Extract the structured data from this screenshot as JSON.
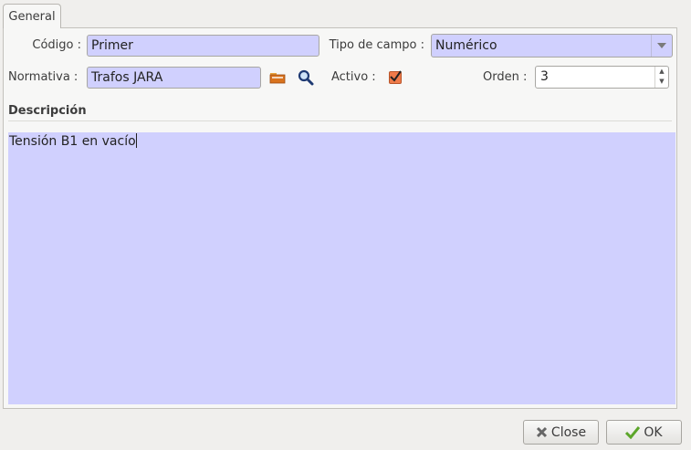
{
  "tabs": [
    {
      "label": "General",
      "active": true
    }
  ],
  "form": {
    "codigo": {
      "label": "Código :",
      "value": "Primer"
    },
    "tipo_campo": {
      "label": "Tipo de campo :",
      "value": "Numérico"
    },
    "normativa": {
      "label": "Normativa :",
      "value": "Trafos JARA"
    },
    "activo": {
      "label": "Activo :",
      "checked": true
    },
    "orden": {
      "label": "Orden :",
      "value": "3"
    }
  },
  "descripcion": {
    "title": "Descripción",
    "value": "Tensión B1 en vacío"
  },
  "buttons": {
    "close_label": "Close",
    "ok_label": "OK"
  },
  "colors": {
    "field_bg": "#d0d0fe",
    "checkbox": "#ef7b4a"
  }
}
